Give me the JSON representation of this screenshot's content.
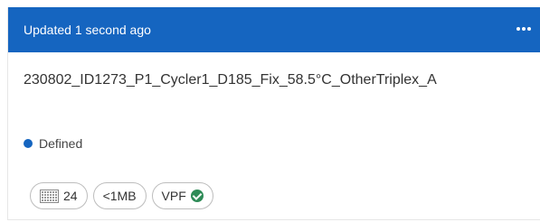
{
  "header": {
    "updated_text": "Updated 1 second ago",
    "background_color": "#1565c0"
  },
  "run": {
    "name": "230802_ID1273_P1_Cycler1_D185_Fix_58.5°C_OtherTriplex_A"
  },
  "status": {
    "label": "Defined",
    "color": "#1565c0"
  },
  "chips": {
    "wells": {
      "icon": "plate-grid-icon",
      "value": "24"
    },
    "size": {
      "value": "<1MB"
    },
    "vpf": {
      "label": "VPF",
      "icon": "check-circle-icon",
      "color": "#2e8b57"
    }
  }
}
